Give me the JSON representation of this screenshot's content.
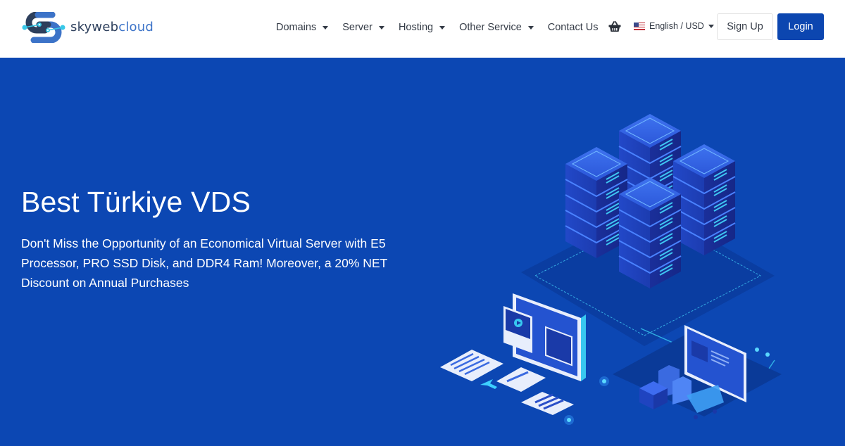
{
  "brand": {
    "name_part1": "skyweb",
    "name_part2": "cloud",
    "logo_icon": "skywebcloud-s-logo",
    "colors": {
      "primary": "#0c46b0",
      "hero_bg": "#0c47b3",
      "logo_dark": "#2d3f5c",
      "logo_blue": "#3c73c8",
      "accent_cyan": "#38c8e8"
    }
  },
  "nav": {
    "items": [
      {
        "label": "Domains",
        "has_dropdown": true
      },
      {
        "label": "Server",
        "has_dropdown": true
      },
      {
        "label": "Hosting",
        "has_dropdown": true
      },
      {
        "label": "Other Service",
        "has_dropdown": true
      },
      {
        "label": "Contact Us",
        "has_dropdown": false
      }
    ],
    "cart_icon": "shopping-basket-icon",
    "language": {
      "label": "English / USD",
      "flag": "us-flag-icon"
    },
    "signup_label": "Sign Up",
    "login_label": "Login"
  },
  "hero": {
    "title": "Best Türkiye VDS",
    "description": "Don't Miss the Opportunity of an Economical Virtual Server with E5 Processor, PRO SSD Disk, and DDR4 Ram! Moreover, a 20% NET Discount on Annual Purchases",
    "illustration": "isometric-servers-and-ecommerce-illustration"
  }
}
